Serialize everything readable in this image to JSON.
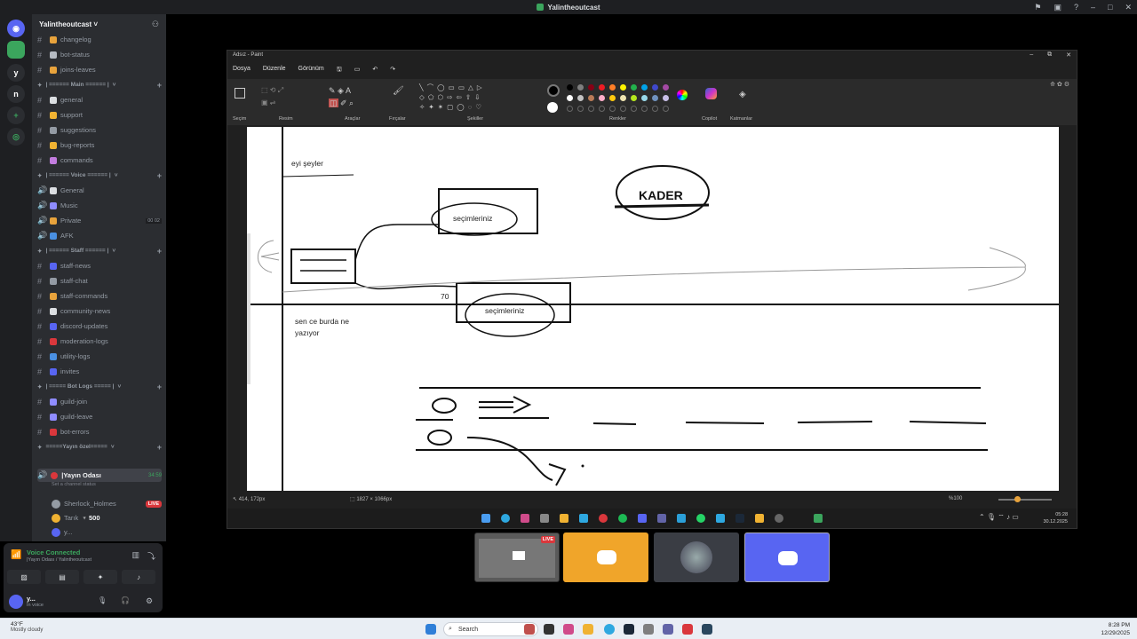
{
  "window": {
    "title": "Yalintheoutcast"
  },
  "rail": {
    "items": [
      "y",
      "n"
    ]
  },
  "server": {
    "name": "Yalintheoutcast"
  },
  "channels": [
    {
      "type": "text",
      "name": "changelog",
      "color": "#e8a33c"
    },
    {
      "type": "text",
      "name": "bot-status",
      "color": "#b5bac1"
    },
    {
      "type": "text",
      "name": "joins-leaves",
      "color": "#e8a33c"
    },
    {
      "type": "cat",
      "name": "| ====== Main ====== |"
    },
    {
      "type": "text",
      "name": "general",
      "color": "#dbdee1"
    },
    {
      "type": "text",
      "name": "support",
      "color": "#f0b232"
    },
    {
      "type": "text",
      "name": "suggestions",
      "color": "#949ba4"
    },
    {
      "type": "text",
      "name": "bug-reports",
      "color": "#f0b232"
    },
    {
      "type": "text",
      "name": "commands",
      "color": "#c27cde"
    },
    {
      "type": "cat",
      "name": "| ====== Voice ====== |"
    },
    {
      "type": "voice",
      "name": "General",
      "color": "#dbdee1"
    },
    {
      "type": "voice",
      "name": "Music",
      "color": "#8f8cff"
    },
    {
      "type": "voice",
      "name": "Private",
      "color": "#e8a33c",
      "badge1": "00",
      "badge2": "02"
    },
    {
      "type": "voice",
      "name": "AFK",
      "color": "#4a90e2"
    },
    {
      "type": "cat",
      "name": "| ====== Staff ====== |"
    },
    {
      "type": "text",
      "name": "staff-news",
      "color": "#5865f2"
    },
    {
      "type": "text",
      "name": "staff-chat",
      "color": "#949ba4"
    },
    {
      "type": "text",
      "name": "staff-commands",
      "color": "#e8a33c"
    },
    {
      "type": "text",
      "name": "community-news",
      "color": "#dbdee1"
    },
    {
      "type": "text",
      "name": "discord-updates",
      "color": "#5865f2"
    },
    {
      "type": "text",
      "name": "moderation-logs",
      "color": "#da373c"
    },
    {
      "type": "text",
      "name": "utility-logs",
      "color": "#4a90e2"
    },
    {
      "type": "text",
      "name": "invites",
      "color": "#5865f2"
    },
    {
      "type": "cat",
      "name": "| ===== Bot Logs ===== |"
    },
    {
      "type": "text",
      "name": "guild-join",
      "color": "#8f8cff"
    },
    {
      "type": "text",
      "name": "guild-leave",
      "color": "#8f8cff"
    },
    {
      "type": "text",
      "name": "bot-errors",
      "color": "#da373c"
    },
    {
      "type": "cat",
      "name": "=====Yayın özel====="
    }
  ],
  "live_channel": {
    "name": "|Yayın Odası",
    "timer": "34:59",
    "sub": "Set a channel status"
  },
  "members": [
    {
      "name": "Sherlock_Holmes",
      "live": "LIVE",
      "color": "#949ba4"
    },
    {
      "name": "Tarık",
      "extra": "500",
      "color": "#f0b232"
    },
    {
      "name": "y...",
      "color": "#5865f2"
    }
  ],
  "voice_panel": {
    "status": "Voice Connected",
    "channel": "|Yayın Odası / Yalintheoutcast"
  },
  "user": {
    "name": "y...",
    "sub": "In voice"
  },
  "paint": {
    "title": "Adsız - Paint",
    "menus": [
      "Dosya",
      "Düzenle",
      "Görünüm"
    ],
    "groups": [
      "Seçim",
      "Resim",
      "Araçlar",
      "Fırçalar",
      "Şekiller",
      "Renkler",
      "Copilot",
      "Katmanlar"
    ],
    "colors": [
      "#000000",
      "#7f7f7f",
      "#880015",
      "#ed1c24",
      "#ff7f27",
      "#fff200",
      "#22b14c",
      "#00a2e8",
      "#3f48cc",
      "#a349a4",
      "#ffffff",
      "#c3c3c3",
      "#b97a57",
      "#ffaec9",
      "#ffc90e",
      "#efe4b0",
      "#b5e61d",
      "#99d9ea",
      "#7092be",
      "#c8bfe7"
    ],
    "canvas_texts": {
      "t1": "eyi şeyler",
      "t2": "seçimleriniz",
      "t3": "seçimleriniz",
      "t4": "70",
      "t5a": "sen ce burda ne",
      "t5b": "yazıyor",
      "kader": "KADER"
    },
    "status": {
      "pos": "414, 172px",
      "size": "1827 × 1066px",
      "zoom": "%100"
    },
    "clock": {
      "time": "05:28",
      "date": "30.12.2025"
    }
  },
  "taskbar": {
    "weather_temp": "43°F",
    "weather_desc": "Mostly cloudy",
    "search": "Search",
    "time": "8:28 PM",
    "date": "12/29/2025"
  }
}
